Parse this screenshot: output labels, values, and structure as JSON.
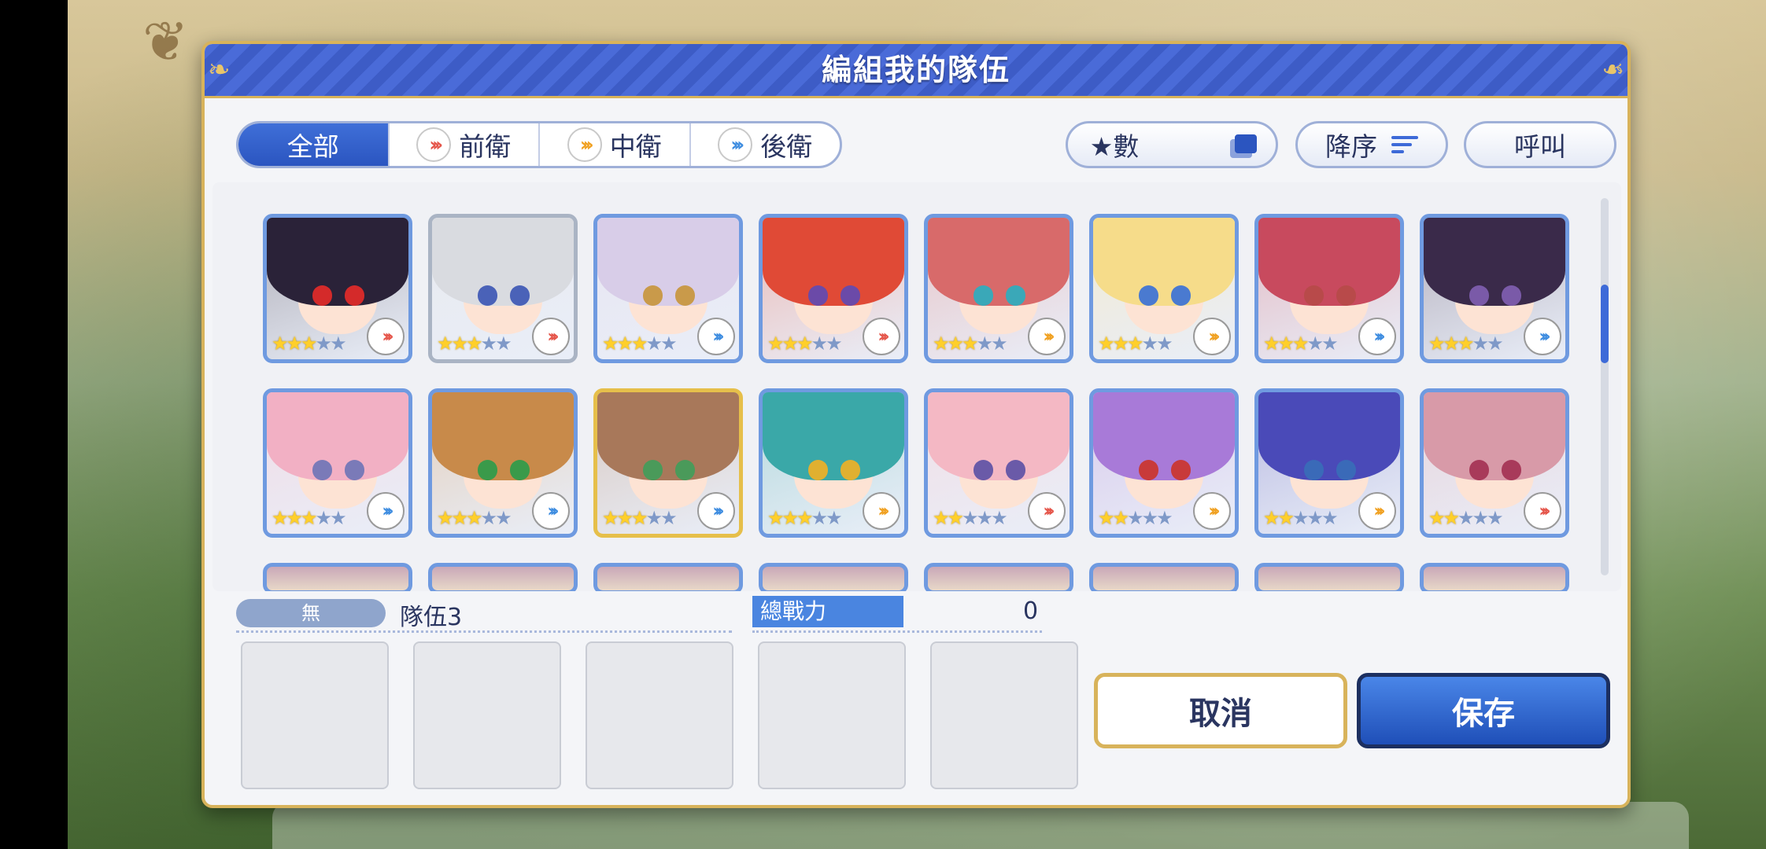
{
  "dialog": {
    "title": "編組我的隊伍"
  },
  "filters": {
    "tabs": [
      {
        "label": "全部",
        "active": true
      },
      {
        "label": "前衛",
        "chevron_color": "#e5554a"
      },
      {
        "label": "中衛",
        "chevron_color": "#f0a020"
      },
      {
        "label": "後衛",
        "chevron_color": "#3d8ce0"
      }
    ],
    "sort_key": "★數",
    "sort_order": "降序",
    "call": "呼叫"
  },
  "roster": {
    "rows": [
      [
        {
          "hair": "#2a2238",
          "eye": "#d42a2a",
          "stars": 3,
          "max": 5,
          "role": "front",
          "frame": "blue"
        },
        {
          "hair": "#d9dbe0",
          "eye": "#4a62b8",
          "stars": 3,
          "max": 5,
          "role": "front",
          "frame": "silver"
        },
        {
          "hair": "#d8cde8",
          "eye": "#c99a4a",
          "stars": 3,
          "max": 5,
          "role": "back",
          "frame": "blue"
        },
        {
          "hair": "#e04a36",
          "eye": "#6b4aa8",
          "stars": 3,
          "max": 5,
          "role": "front",
          "frame": "blue"
        },
        {
          "hair": "#d86a6a",
          "eye": "#3aa8b8",
          "stars": 3,
          "max": 5,
          "role": "mid",
          "frame": "blue"
        },
        {
          "hair": "#f6dc8a",
          "eye": "#4a7ad0",
          "stars": 3,
          "max": 5,
          "role": "mid",
          "frame": "blue"
        },
        {
          "hair": "#c84a5e",
          "eye": "#b84a4a",
          "stars": 3,
          "max": 5,
          "role": "back",
          "frame": "blue"
        },
        {
          "hair": "#3a2a4a",
          "eye": "#7a5aa8",
          "stars": 3,
          "max": 5,
          "role": "back",
          "frame": "blue"
        }
      ],
      [
        {
          "hair": "#f2b0c4",
          "eye": "#7a7ab8",
          "stars": 3,
          "max": 5,
          "role": "back",
          "frame": "blue"
        },
        {
          "hair": "#c88a4a",
          "eye": "#3a9a4a",
          "stars": 3,
          "max": 5,
          "role": "back",
          "frame": "blue"
        },
        {
          "hair": "#a8785a",
          "eye": "#4a9a5a",
          "stars": 3,
          "max": 5,
          "role": "back",
          "frame": "gold"
        },
        {
          "hair": "#3aa8a8",
          "eye": "#e0b030",
          "stars": 3,
          "max": 5,
          "role": "mid",
          "frame": "blue"
        },
        {
          "hair": "#f4b8c4",
          "eye": "#6a5aa8",
          "stars": 2,
          "max": 5,
          "role": "front",
          "frame": "blue"
        },
        {
          "hair": "#a87ad8",
          "eye": "#c83a3a",
          "stars": 2,
          "max": 5,
          "role": "mid",
          "frame": "blue"
        },
        {
          "hair": "#4a4ab8",
          "eye": "#3a6ab8",
          "stars": 2,
          "max": 5,
          "role": "mid",
          "frame": "blue"
        },
        {
          "hair": "#d89aa8",
          "eye": "#a83a5a",
          "stars": 2,
          "max": 5,
          "role": "front",
          "frame": "blue"
        }
      ]
    ]
  },
  "team": {
    "tag": "無",
    "name": "隊伍3",
    "power_label": "總戰力",
    "power_value": "0",
    "slot_count": 5
  },
  "actions": {
    "cancel": "取消",
    "save": "保存"
  }
}
